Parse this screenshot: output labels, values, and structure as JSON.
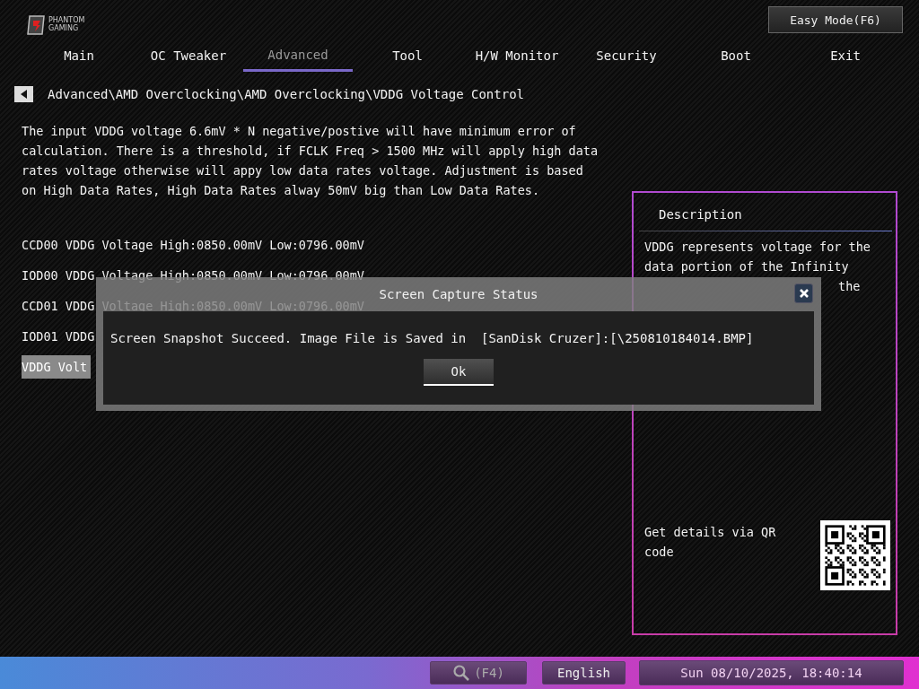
{
  "logo": {
    "brand": "PHANTOM GAMING"
  },
  "easy_mode_button": "Easy Mode(F6)",
  "tabs": [
    {
      "label": "Main",
      "selected": false
    },
    {
      "label": "OC Tweaker",
      "selected": false
    },
    {
      "label": "Advanced",
      "selected": true
    },
    {
      "label": "Tool",
      "selected": false
    },
    {
      "label": "H/W Monitor",
      "selected": false
    },
    {
      "label": "Security",
      "selected": false
    },
    {
      "label": "Boot",
      "selected": false
    },
    {
      "label": "Exit",
      "selected": false
    }
  ],
  "breadcrumb": "Advanced\\AMD Overclocking\\AMD Overclocking\\VDDG Voltage Control",
  "help_text": "The input VDDG voltage 6.6mV * N negative/postive will have minimum error of calculation. There is a threshold, if FCLK Freq > 1500 MHz will apply high data rates voltage otherwise will appy low data rates voltage. Adjustment is based on High Data Rates, High Data Rates alway 50mV big than Low Data Rates.",
  "items": [
    {
      "label": "CCD00 VDDG Voltage High:0850.00mV Low:0796.00mV",
      "selected": false
    },
    {
      "label": "IOD00 VDDG Voltage High:0850.00mV Low:0796.00mV",
      "selected": false
    },
    {
      "label": "CCD01 VDDG Voltage High:0850.00mV Low:0796.00mV",
      "selected": false
    },
    {
      "label": "IOD01 VDDG",
      "selected": false
    },
    {
      "label": "VDDG Volt",
      "selected": true
    }
  ],
  "description": {
    "title": "Description",
    "text_lines": [
      "VDDG represents voltage for the",
      "data portion of the Infinity"
    ],
    "text_tail": "the",
    "qr_caption": "Get details via QR code"
  },
  "dialog": {
    "title": "Screen Capture Status",
    "message": "Screen Snapshot Succeed. Image File is Saved in  [SanDisk Cruzer]:[\\250810184014.BMP]",
    "ok_button": "Ok"
  },
  "status_bar": {
    "search_key": "(F4)",
    "language": "English",
    "datetime": "Sun 08/10/2025, 18:40:14"
  }
}
